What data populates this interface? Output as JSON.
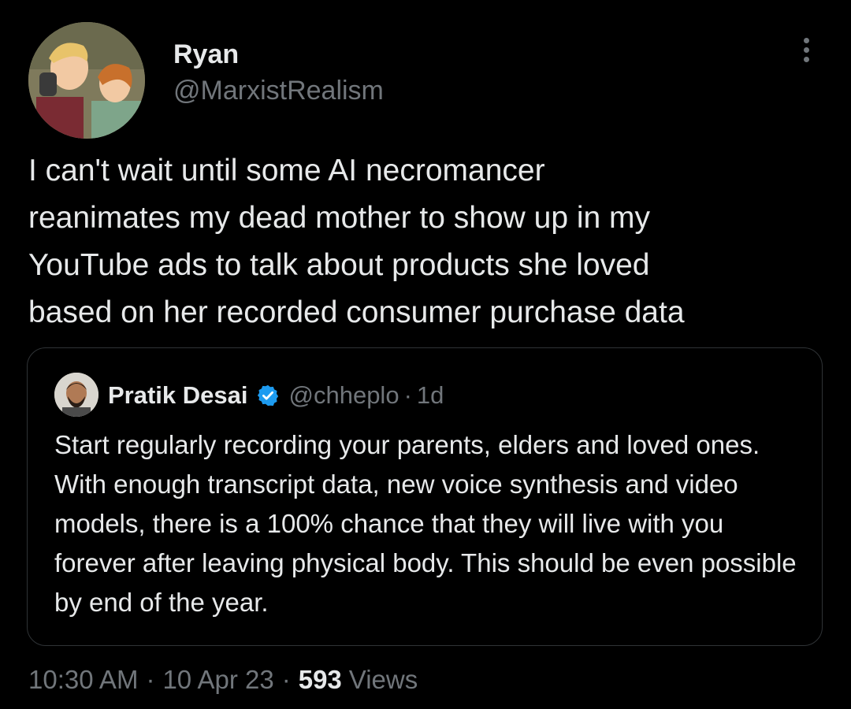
{
  "tweet": {
    "author": {
      "name": "Ryan",
      "handle": "@MarxistRealism",
      "avatar_icon": "cartoon-avatar"
    },
    "text": "I can't wait until some AI necromancer\nreanimates my dead mother to show up in my\nYouTube ads to talk about products she loved\nbased on her recorded consumer purchase data",
    "more_icon": "more-vertical-icon",
    "quoted": {
      "name": "Pratik Desai",
      "verified": true,
      "verified_color": "#1d9bf0",
      "handle": "@chheplo",
      "separator": "·",
      "time": "1d",
      "text": "Start regularly recording your parents, elders and loved ones. With enough transcript data, new voice synthesis and video models, there is a 100% chance that they will live with you forever after leaving physical body. This should be even possible by end of the year."
    },
    "meta": {
      "time": "10:30 AM",
      "separator": "·",
      "date": "10 Apr 23",
      "views_count": "593",
      "views_label": "Views"
    }
  },
  "colors": {
    "background": "#000000",
    "text_primary": "#e7e9ea",
    "text_secondary": "#71767b",
    "border": "#2f3336"
  }
}
